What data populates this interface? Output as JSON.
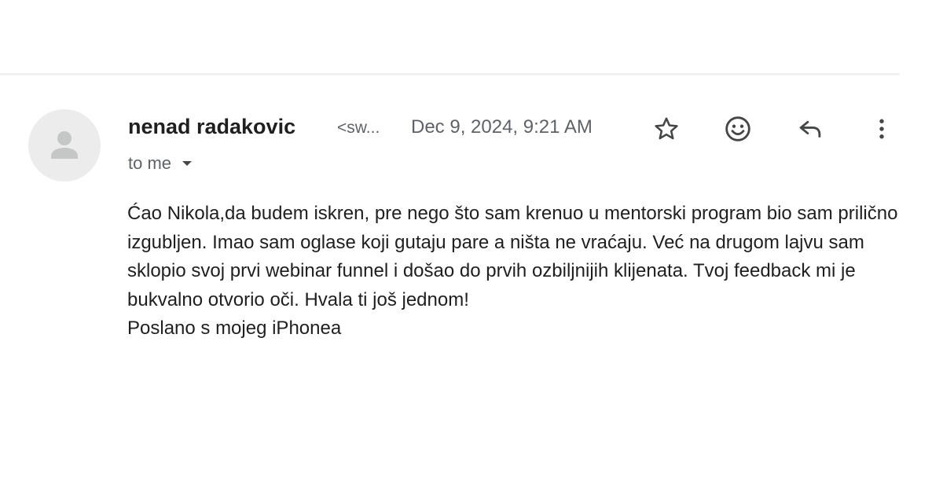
{
  "email": {
    "sender_name": "nenad radakovic",
    "sender_email_truncated": "<sw...",
    "date": "Dec 9, 2024, 9:21 AM",
    "recipient_label": "to me",
    "body_paragraphs": [
      "Ćao Nikola,da budem iskren, pre nego što sam krenuo u mentorski program bio sam prilično izgubljen. Imao sam oglase koji gutaju pare a ništa ne vraćaju. Već na drugom lajvu sam sklopio svoj prvi webinar funnel i došao do prvih ozbiljnijih klijenata. Tvoj feedback mi je bukvalno otvorio oči. Hvala ti još jednom!",
      "Poslano s mojeg iPhonea"
    ]
  },
  "icons": {
    "avatar": "person-icon",
    "star": "star-icon",
    "emoji": "emoji-reaction-icon",
    "reply": "reply-icon",
    "more": "more-vert-icon",
    "recipient_dropdown": "caret-down-icon"
  },
  "colors": {
    "text_primary": "#1f1f1f",
    "text_secondary": "#5f6368",
    "icon": "#444746",
    "avatar_bg": "#ececec",
    "avatar_fg": "#c4c7c5"
  }
}
